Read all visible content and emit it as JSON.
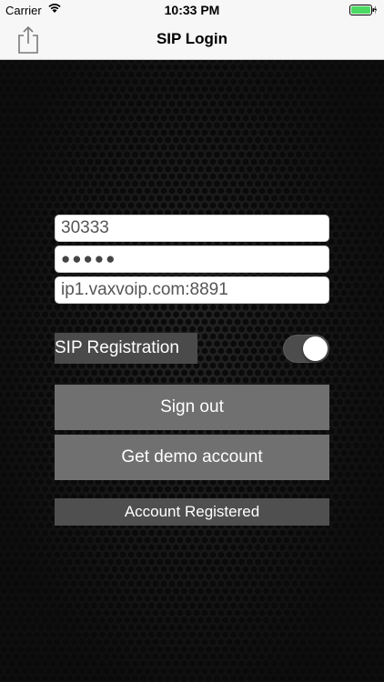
{
  "status_bar": {
    "carrier": "Carrier",
    "time": "10:33 PM",
    "wifi_icon": "wifi-icon",
    "battery_icon": "battery-charging-icon",
    "battery_color": "#4cd964"
  },
  "nav": {
    "title": "SIP Login",
    "share_icon": "share-icon"
  },
  "form": {
    "username_value": "30333",
    "password_value": "●●●●●",
    "server_value": "ip1.vaxvoip.com:8891"
  },
  "registration": {
    "label": "SIP Registration",
    "toggle_on": true
  },
  "buttons": {
    "sign_out": "Sign out",
    "demo_account": "Get demo account"
  },
  "status_message": "Account Registered"
}
